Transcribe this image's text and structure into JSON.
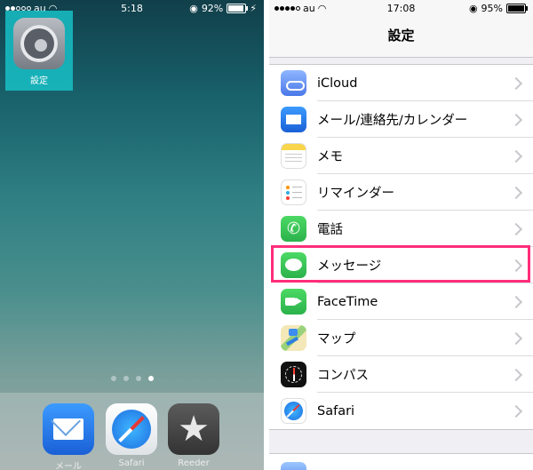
{
  "home": {
    "status": {
      "carrier": "au",
      "time": "5:18",
      "battery": "92%",
      "battery_level": 0.92
    },
    "apps": [
      {
        "label": "設定",
        "icon": "gear-icon"
      }
    ],
    "page_dots": {
      "count": 4,
      "active": 3
    },
    "dock": [
      {
        "label": "メール",
        "icon": "mail-icon"
      },
      {
        "label": "Safari",
        "icon": "safari-icon"
      },
      {
        "label": "Reeder",
        "icon": "star-icon"
      }
    ]
  },
  "settings": {
    "status": {
      "carrier": "au",
      "time": "17:08",
      "battery": "95%",
      "battery_level": 0.95
    },
    "title": "設定",
    "rows": [
      {
        "label": "iCloud",
        "icon": "icloud-icon"
      },
      {
        "label": "メール/連絡先/カレンダー",
        "icon": "mail-icon"
      },
      {
        "label": "メモ",
        "icon": "notes-icon"
      },
      {
        "label": "リマインダー",
        "icon": "reminders-icon"
      },
      {
        "label": "電話",
        "icon": "phone-icon"
      },
      {
        "label": "メッセージ",
        "icon": "messages-icon",
        "highlighted": true
      },
      {
        "label": "FaceTime",
        "icon": "facetime-icon"
      },
      {
        "label": "マップ",
        "icon": "maps-icon"
      },
      {
        "label": "コンパス",
        "icon": "compass-icon"
      },
      {
        "label": "Safari",
        "icon": "safari-icon"
      }
    ],
    "highlight_color": "#ff2d7a"
  }
}
